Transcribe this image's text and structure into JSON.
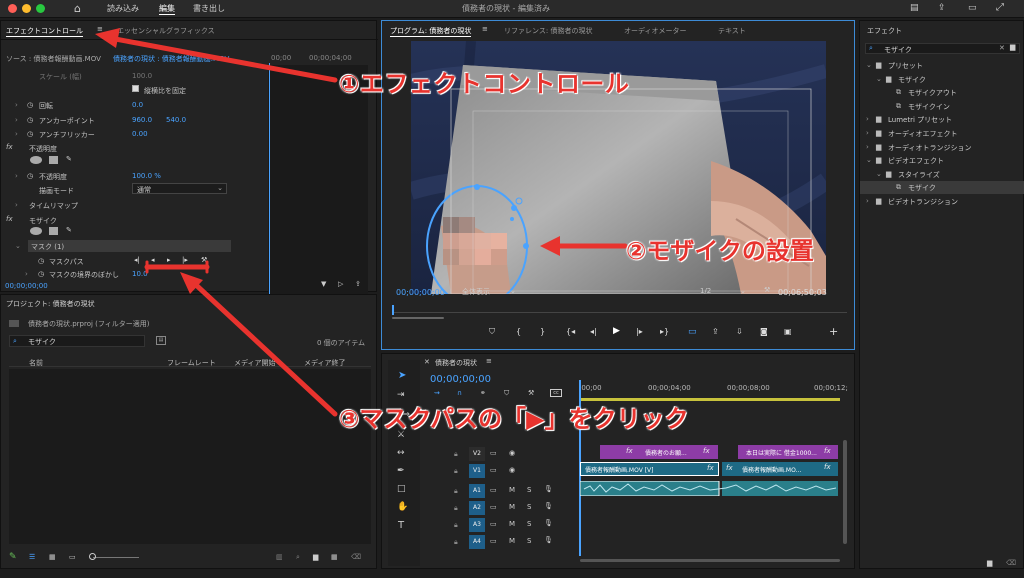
{
  "titlebar": {
    "nav": [
      "読み込み",
      "編集",
      "書き出し"
    ],
    "active_nav": "編集",
    "project_title": "債務者の現状 - 編集済み"
  },
  "effect_controls": {
    "tab_active": "エフェクトコントロール",
    "tab_other": "エッセンシャルグラフィックス",
    "source": "ソース : 債務者報酬動画.MOV",
    "source_link": "債務者の現状 : 債務者報酬動画.MOV",
    "timecodes": [
      "00;00",
      "00;00;04;00"
    ],
    "rows": [
      {
        "label": "スケール (幅)",
        "value": "100.0"
      },
      {
        "label": "縦横比を固定",
        "value": ""
      },
      {
        "label": "回転",
        "value": "0.0"
      },
      {
        "label": "アンカーポイント",
        "value": "960.0",
        "value2": "540.0"
      },
      {
        "label": "アンチフリッカー",
        "value": "0.00"
      },
      {
        "label": "不透明度",
        "value": ""
      },
      {
        "label": "不透明度",
        "value": "100.0 %"
      },
      {
        "label": "描画モード",
        "value": "通常"
      },
      {
        "label": "タイムリマップ",
        "value": ""
      },
      {
        "label": "モザイク",
        "value": ""
      },
      {
        "label": "マスク (1)",
        "value": ""
      },
      {
        "label": "マスクパス",
        "value": ""
      },
      {
        "label": "マスクの境界のぼかし",
        "value": "10.0"
      }
    ],
    "footer_timecode": "00;00;00;00"
  },
  "project": {
    "title": "プロジェクト: 債務者の現状",
    "file": "債務者の現状.prproj (フィルター適用)",
    "search_value": "モザイク",
    "item_count": "0 個のアイテム",
    "columns": [
      "名前",
      "フレームレート",
      "メディア開始",
      "メディア終了"
    ]
  },
  "program": {
    "tabs": [
      "プログラム: 債務者の現状",
      "リファレンス: 債務者の現状",
      "オーディオメーター",
      "テキスト"
    ],
    "timecode": "00;00;00;00",
    "fit": "全体表示",
    "resolution": "1/2",
    "duration": "00;06;50;03"
  },
  "effects": {
    "title": "エフェクト",
    "search_value": "モザイク",
    "tree": [
      {
        "label": "プリセット",
        "level": 0,
        "kind": "folder"
      },
      {
        "label": "モザイク",
        "level": 1,
        "kind": "folder"
      },
      {
        "label": "モザイクアウト",
        "level": 2,
        "kind": "item"
      },
      {
        "label": "モザイクイン",
        "level": 2,
        "kind": "item"
      },
      {
        "label": "Lumetri プリセット",
        "level": 0,
        "kind": "folder"
      },
      {
        "label": "オーディオエフェクト",
        "level": 0,
        "kind": "folder"
      },
      {
        "label": "オーディオトランジション",
        "level": 0,
        "kind": "folder"
      },
      {
        "label": "ビデオエフェクト",
        "level": 0,
        "kind": "folder"
      },
      {
        "label": "スタイライズ",
        "level": 1,
        "kind": "folder"
      },
      {
        "label": "モザイク",
        "level": 2,
        "kind": "item",
        "selected": true
      },
      {
        "label": "ビデオトランジション",
        "level": 0,
        "kind": "folder"
      }
    ]
  },
  "timeline": {
    "title": "債務者の現状",
    "timecode": "00;00;00;00",
    "ruler": [
      ":00;00",
      "00;00;04;00",
      "00;00;08;00",
      "00;00;12;"
    ],
    "video_tracks": [
      "V2",
      "V1"
    ],
    "audio_tracks": [
      "A1",
      "A2",
      "A3",
      "A4"
    ],
    "clips": {
      "v2a": "債務者のお願...",
      "v2b": "本日は実際に 借金1000...",
      "v1a": "債務者報酬動画.MOV [V]",
      "v1b": "債務者報酬動画.MO..."
    }
  },
  "annotations": {
    "a1": "①エフェクトコントロール",
    "a2": "②モザイクの設置",
    "a3": "③マスクパスの「▶」をクリック"
  },
  "colors": {
    "accent": "#4aa3ff",
    "annotation": "#e8332e",
    "clip_video": "#1e6a85",
    "clip_graphic": "#8d3ca6",
    "clip_audio": "#2a7f8a"
  }
}
